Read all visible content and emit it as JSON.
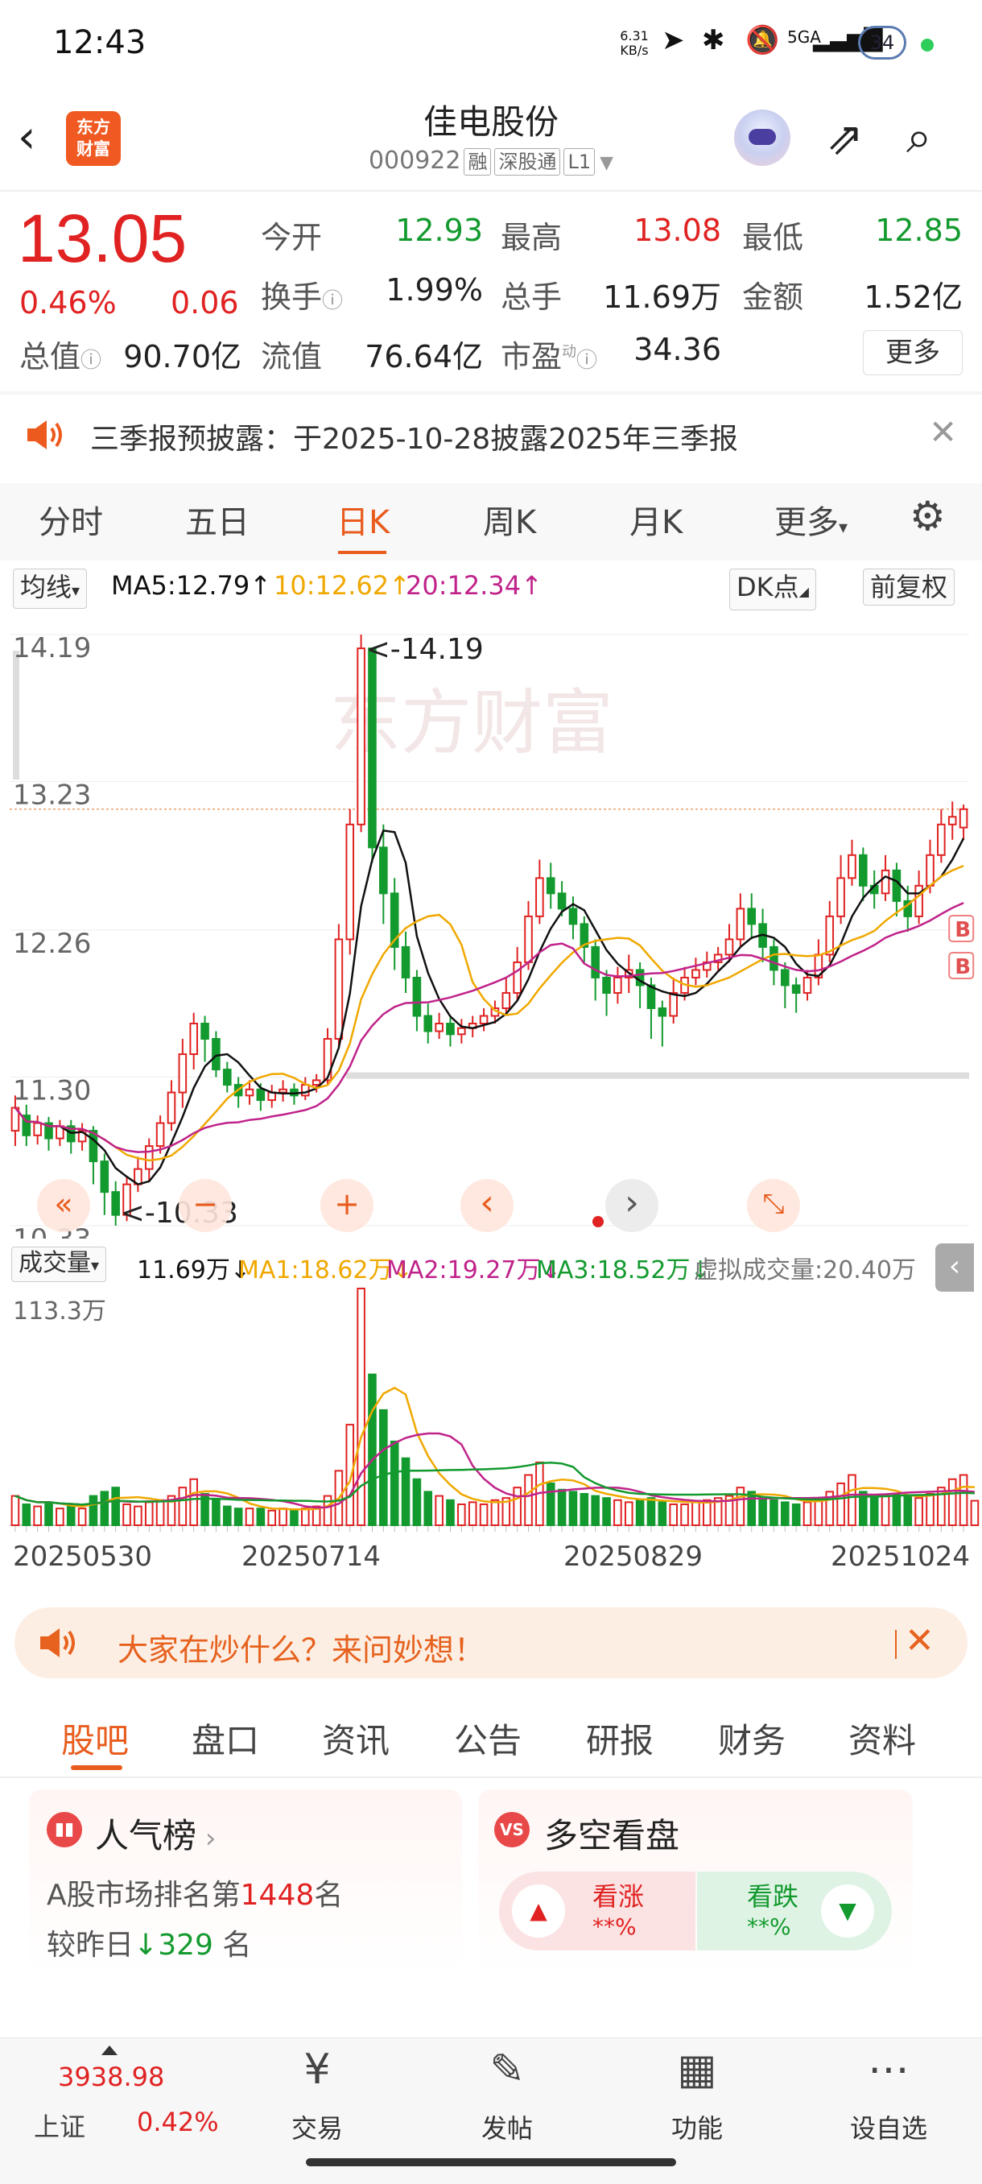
{
  "status_bar": {
    "time": "12:43",
    "net_speed_value": "6.31",
    "net_speed_unit": "KB/s",
    "network": "5GA",
    "battery": "34"
  },
  "header": {
    "logo_line1": "东方",
    "logo_line2": "财富",
    "name": "佳电股份",
    "code": "000922",
    "tags": [
      "融",
      "深股通",
      "L1"
    ]
  },
  "quote": {
    "price": "13.05",
    "change_pct": "0.46%",
    "change_abs": "0.06",
    "open_label": "今开",
    "open": "12.93",
    "high_label": "最高",
    "high": "13.08",
    "low_label": "最低",
    "low": "12.85",
    "turnover_label": "换手",
    "turnover": "1.99%",
    "volume_label": "总手",
    "volume": "11.69万",
    "amount_label": "金额",
    "amount": "1.52亿",
    "mktcap_label": "总值",
    "mktcap": "90.70亿",
    "float_label": "流值",
    "float": "76.64亿",
    "pe_label": "市盈",
    "pe_sup": "动",
    "pe": "34.36",
    "more": "更多"
  },
  "notice": {
    "text": "三季报预披露：于2025-10-28披露2025年三季报"
  },
  "chart_tabs": [
    {
      "label": "分时"
    },
    {
      "label": "五日"
    },
    {
      "label": "日K"
    },
    {
      "label": "周K"
    },
    {
      "label": "月K"
    },
    {
      "label": "更多"
    }
  ],
  "ma_bar": {
    "selector": "均线",
    "ma5": "MA5:12.79",
    "ma10": "10:12.62",
    "ma20": "20:12.34",
    "dk": "DK点",
    "fq": "前复权"
  },
  "colors": {
    "up": "#e02222",
    "down": "#139a2f",
    "ma5": "#111111",
    "ma10": "#f0a800",
    "ma20": "#c0238a",
    "accent": "#e85c1e"
  },
  "chart_data": [
    {
      "type": "candlestick",
      "y_ticks": [
        "14.19",
        "13.23",
        "12.26",
        "11.30",
        "10.33"
      ],
      "ylim": [
        10.33,
        14.19
      ],
      "high_annotation": "<-14.19",
      "low_annotation": "<-10.33",
      "current_price_line": 13.05,
      "markers": [
        "B",
        "B"
      ],
      "candles": [
        [
          10.95,
          11.1,
          10.85,
          11.18
        ],
        [
          11.05,
          10.92,
          10.85,
          11.12
        ],
        [
          10.92,
          11.0,
          10.86,
          11.05
        ],
        [
          11.0,
          10.9,
          10.82,
          11.04
        ],
        [
          10.9,
          10.98,
          10.85,
          11.02
        ],
        [
          10.98,
          10.88,
          10.8,
          11.02
        ],
        [
          10.88,
          10.95,
          10.82,
          11.0
        ],
        [
          10.95,
          10.75,
          10.6,
          10.98
        ],
        [
          10.75,
          10.55,
          10.4,
          10.8
        ],
        [
          10.55,
          10.4,
          10.33,
          10.62
        ],
        [
          10.4,
          10.6,
          10.36,
          10.65
        ],
        [
          10.6,
          10.7,
          10.55,
          10.78
        ],
        [
          10.7,
          10.85,
          10.62,
          10.9
        ],
        [
          10.85,
          11.0,
          10.8,
          11.05
        ],
        [
          11.0,
          11.2,
          10.95,
          11.28
        ],
        [
          11.2,
          11.45,
          11.1,
          11.55
        ],
        [
          11.45,
          11.65,
          11.35,
          11.72
        ],
        [
          11.65,
          11.55,
          11.4,
          11.7
        ],
        [
          11.55,
          11.35,
          11.3,
          11.6
        ],
        [
          11.35,
          11.25,
          11.2,
          11.4
        ],
        [
          11.25,
          11.18,
          11.1,
          11.3
        ],
        [
          11.18,
          11.22,
          11.12,
          11.28
        ],
        [
          11.22,
          11.15,
          11.08,
          11.26
        ],
        [
          11.15,
          11.2,
          11.1,
          11.25
        ],
        [
          11.2,
          11.22,
          11.14,
          11.28
        ],
        [
          11.22,
          11.18,
          11.12,
          11.26
        ],
        [
          11.18,
          11.25,
          11.15,
          11.3
        ],
        [
          11.25,
          11.28,
          11.2,
          11.32
        ],
        [
          11.28,
          11.55,
          11.25,
          11.62
        ],
        [
          11.55,
          12.2,
          11.5,
          12.3
        ],
        [
          12.2,
          12.95,
          12.1,
          13.05
        ],
        [
          12.95,
          14.1,
          12.9,
          14.19
        ],
        [
          14.1,
          12.8,
          12.7,
          14.1
        ],
        [
          12.8,
          12.5,
          12.3,
          12.95
        ],
        [
          12.5,
          12.15,
          12.0,
          12.6
        ],
        [
          12.15,
          11.95,
          11.85,
          12.25
        ],
        [
          11.95,
          11.7,
          11.6,
          12.0
        ],
        [
          11.7,
          11.6,
          11.52,
          11.78
        ],
        [
          11.6,
          11.65,
          11.55,
          11.72
        ],
        [
          11.65,
          11.58,
          11.5,
          11.7
        ],
        [
          11.58,
          11.62,
          11.52,
          11.68
        ],
        [
          11.62,
          11.65,
          11.56,
          11.7
        ],
        [
          11.65,
          11.7,
          11.6,
          11.75
        ],
        [
          11.7,
          11.75,
          11.65,
          11.8
        ],
        [
          11.75,
          11.85,
          11.7,
          11.95
        ],
        [
          11.85,
          12.05,
          11.8,
          12.15
        ],
        [
          12.05,
          12.35,
          12.0,
          12.45
        ],
        [
          12.35,
          12.6,
          12.3,
          12.72
        ],
        [
          12.6,
          12.5,
          12.4,
          12.7
        ],
        [
          12.5,
          12.4,
          12.35,
          12.58
        ],
        [
          12.4,
          12.3,
          12.2,
          12.48
        ],
        [
          12.3,
          12.15,
          12.05,
          12.35
        ],
        [
          12.15,
          11.95,
          11.8,
          12.2
        ],
        [
          11.95,
          11.85,
          11.7,
          12.0
        ],
        [
          11.85,
          11.95,
          11.78,
          12.02
        ],
        [
          11.95,
          12.0,
          11.85,
          12.1
        ],
        [
          12.0,
          11.9,
          11.75,
          12.05
        ],
        [
          11.9,
          11.75,
          11.55,
          11.95
        ],
        [
          11.75,
          11.7,
          11.5,
          11.8
        ],
        [
          11.7,
          11.85,
          11.65,
          11.95
        ],
        [
          11.85,
          11.95,
          11.8,
          12.02
        ],
        [
          11.95,
          12.0,
          11.9,
          12.08
        ],
        [
          12.0,
          12.05,
          11.95,
          12.12
        ],
        [
          12.05,
          12.1,
          12.0,
          12.15
        ],
        [
          12.1,
          12.2,
          12.05,
          12.3
        ],
        [
          12.2,
          12.4,
          12.15,
          12.5
        ],
        [
          12.4,
          12.3,
          12.2,
          12.5
        ],
        [
          12.3,
          12.15,
          12.05,
          12.4
        ],
        [
          12.15,
          12.0,
          11.9,
          12.2
        ],
        [
          12.0,
          11.9,
          11.75,
          12.05
        ],
        [
          11.9,
          11.85,
          11.72,
          11.95
        ],
        [
          11.85,
          11.95,
          11.8,
          12.0
        ],
        [
          11.95,
          12.1,
          11.9,
          12.2
        ],
        [
          12.1,
          12.35,
          12.05,
          12.45
        ],
        [
          12.35,
          12.6,
          12.3,
          12.75
        ],
        [
          12.6,
          12.75,
          12.55,
          12.85
        ],
        [
          12.75,
          12.55,
          12.45,
          12.8
        ],
        [
          12.55,
          12.5,
          12.4,
          12.65
        ],
        [
          12.5,
          12.65,
          12.45,
          12.75
        ],
        [
          12.65,
          12.45,
          12.35,
          12.7
        ],
        [
          12.45,
          12.35,
          12.25,
          12.55
        ],
        [
          12.35,
          12.55,
          12.3,
          12.65
        ],
        [
          12.55,
          12.75,
          12.5,
          12.85
        ],
        [
          12.75,
          12.95,
          12.7,
          13.05
        ],
        [
          12.95,
          13.0,
          12.85,
          13.1
        ],
        [
          12.93,
          13.05,
          12.85,
          13.08
        ]
      ]
    },
    {
      "type": "bar",
      "title": "成交量",
      "current": "11.69万",
      "ma1": "MA1:18.62万",
      "ma2": "MA2:19.27万",
      "ma3": "MA3:18.52万",
      "virtual": "虚拟成交量:20.40万",
      "y_max_label": "113.3万",
      "x_ticks": [
        "20250530",
        "20250714",
        "20250829",
        "20251024"
      ],
      "values": [
        14,
        10,
        9,
        11,
        8,
        9,
        8,
        14,
        16,
        18,
        10,
        9,
        11,
        12,
        14,
        18,
        22,
        15,
        12,
        9,
        8,
        8,
        8,
        7,
        8,
        7,
        8,
        9,
        14,
        26,
        48,
        113,
        72,
        55,
        40,
        32,
        22,
        16,
        14,
        12,
        10,
        11,
        10,
        12,
        13,
        18,
        24,
        30,
        20,
        17,
        16,
        15,
        14,
        13,
        12,
        11,
        12,
        13,
        11,
        10,
        10,
        11,
        12,
        13,
        14,
        18,
        16,
        13,
        12,
        11,
        10,
        11,
        13,
        16,
        20,
        24,
        16,
        13,
        14,
        15,
        14,
        13,
        15,
        18,
        22,
        24,
        11.69
      ]
    }
  ],
  "chart_nav": {
    "rewind": "«",
    "minus": "−",
    "plus": "+",
    "prev": "‹",
    "next": "›"
  },
  "promo": {
    "text": "大家在炒什么？来问妙想！"
  },
  "section_tabs": [
    {
      "label": "股吧"
    },
    {
      "label": "盘口"
    },
    {
      "label": "资讯"
    },
    {
      "label": "公告"
    },
    {
      "label": "研报"
    },
    {
      "label": "财务"
    },
    {
      "label": "资料"
    }
  ],
  "popularity": {
    "title": "人气榜",
    "line1_prefix": "A股市场排名第",
    "rank": "1448",
    "line1_suffix": "名",
    "line2_prefix": "较昨日",
    "change": "329",
    "line2_suffix": " 名"
  },
  "long_short": {
    "title": "多空看盘",
    "up_label": "看涨",
    "up_value": "**%",
    "down_label": "看跌",
    "down_value": "**%"
  },
  "footer": {
    "index_value": "3938.98",
    "index_name": "上证",
    "index_pct": "0.42%",
    "items": [
      {
        "label": "交易"
      },
      {
        "label": "发帖"
      },
      {
        "label": "功能"
      },
      {
        "label": "设自选"
      }
    ]
  }
}
